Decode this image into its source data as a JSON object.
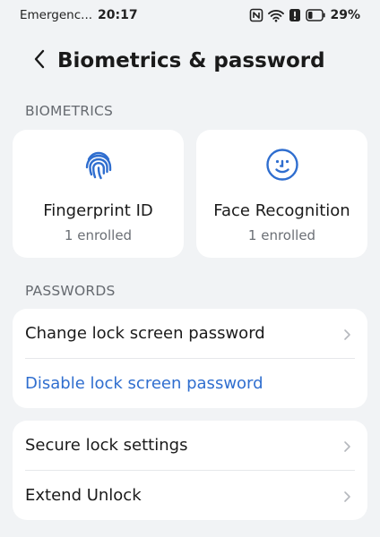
{
  "status_bar": {
    "carrier": "Emergenc...",
    "time": "20:17",
    "battery": "29%",
    "icons": [
      "nfc-icon",
      "wifi-icon",
      "alert-icon",
      "battery-icon"
    ]
  },
  "header": {
    "title": "Biometrics & password",
    "back_icon": "back-arrow-icon"
  },
  "biometrics": {
    "section_label": "BIOMETRICS",
    "cards": [
      {
        "title": "Fingerprint ID",
        "subtitle": "1 enrolled",
        "icon": "fingerprint-icon"
      },
      {
        "title": "Face Recognition",
        "subtitle": "1 enrolled",
        "icon": "face-icon"
      }
    ]
  },
  "passwords": {
    "section_label": "PASSWORDS",
    "items": [
      {
        "label": "Change lock screen password"
      },
      {
        "label": "Disable lock screen password"
      }
    ]
  },
  "lock_group": {
    "items": [
      {
        "label": "Secure lock settings"
      },
      {
        "label": "Extend Unlock"
      }
    ]
  },
  "colors": {
    "accent": "#2f6ecf",
    "background": "#f1f3f5",
    "card": "#ffffff",
    "secondary_text": "#6b6f75"
  }
}
